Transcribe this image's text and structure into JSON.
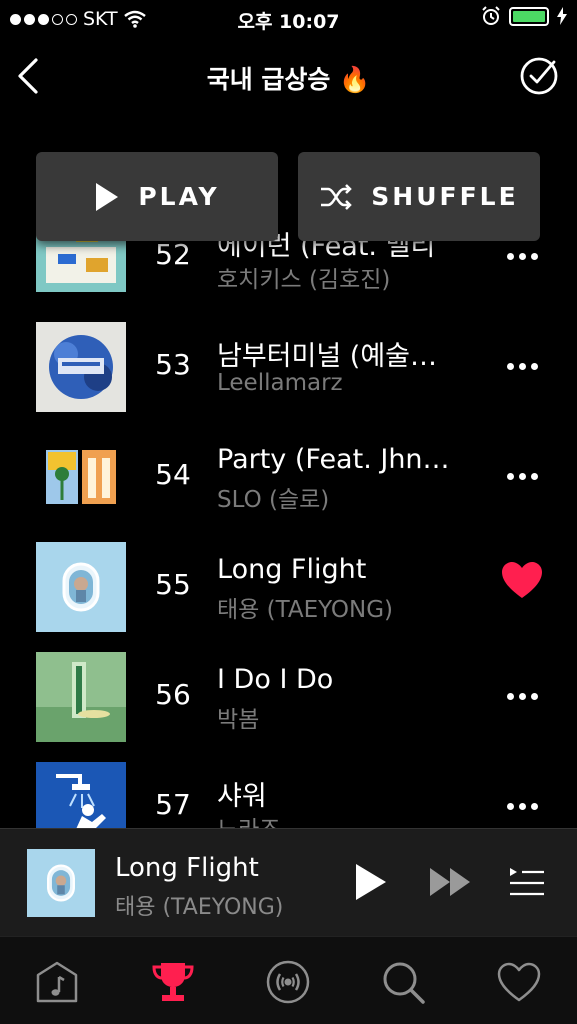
{
  "status": {
    "carrier": "SKT",
    "signal_bars_filled": 3,
    "signal_bars_total": 5,
    "time": "오후 10:07",
    "battery_level": 1.0,
    "battery_color": "#4cd964"
  },
  "nav": {
    "title": "국내 급상승 🔥",
    "back_icon": "chevron-left-icon",
    "select_icon": "check-circle-icon"
  },
  "actions": {
    "play_label": "PLAY",
    "shuffle_label": "SHUFFLE"
  },
  "tracks": [
    {
      "rank": "52",
      "title": "에이런 (Feat. 멜리",
      "artist": "호치키스 (김호진)",
      "liked": false
    },
    {
      "rank": "53",
      "title": "남부터미널 (예술…",
      "artist": "Leellamarz",
      "liked": false
    },
    {
      "rank": "54",
      "title": "Party (Feat. Jhn…",
      "artist": "SLO (슬로)",
      "liked": false
    },
    {
      "rank": "55",
      "title": "Long Flight",
      "artist": "태용 (TAEYONG)",
      "liked": true
    },
    {
      "rank": "56",
      "title": "I Do I Do",
      "artist": "박봄",
      "liked": false
    },
    {
      "rank": "57",
      "title": "샤워",
      "artist": "노라조",
      "liked": false
    }
  ],
  "now_playing": {
    "title": "Long Flight",
    "artist": "태용 (TAEYONG)"
  },
  "tabbar": {
    "items": [
      {
        "icon": "music-note-icon",
        "active": false
      },
      {
        "icon": "trophy-icon",
        "active": true
      },
      {
        "icon": "radio-broadcast-icon",
        "active": false
      },
      {
        "icon": "search-icon",
        "active": false
      },
      {
        "icon": "heart-icon",
        "active": false
      }
    ],
    "active_color": "#ff1f4f",
    "inactive_color": "#8e8e8e"
  },
  "colors": {
    "accent": "#ff1f4f",
    "background": "#000000",
    "secondary_text": "#7b7b7b"
  }
}
